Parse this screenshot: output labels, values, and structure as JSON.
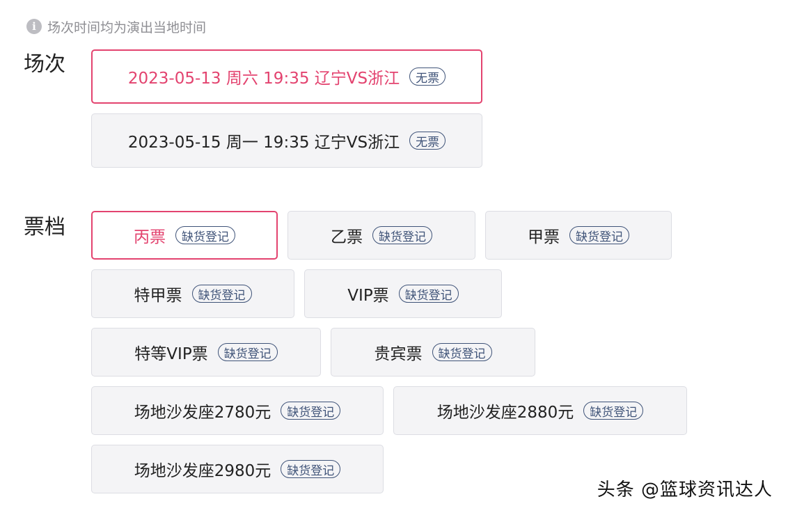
{
  "notice": {
    "icon": "info-icon",
    "text": "场次时间均为演出当地时间"
  },
  "sessions": {
    "label": "场次",
    "items": [
      {
        "text": "2023-05-13 周六 19:35 辽宁VS浙江",
        "tag": "无票",
        "selected": true
      },
      {
        "text": "2023-05-15 周一 19:35 辽宁VS浙江",
        "tag": "无票",
        "selected": false
      }
    ]
  },
  "tiers": {
    "label": "票档",
    "items": [
      {
        "name": "丙票",
        "tag": "缺货登记",
        "selected": true
      },
      {
        "name": "乙票",
        "tag": "缺货登记",
        "selected": false
      },
      {
        "name": "甲票",
        "tag": "缺货登记",
        "selected": false
      },
      {
        "name": "特甲票",
        "tag": "缺货登记",
        "selected": false
      },
      {
        "name": "VIP票",
        "tag": "缺货登记",
        "selected": false
      },
      {
        "name": "特等VIP票",
        "tag": "缺货登记",
        "selected": false
      },
      {
        "name": "贵宾票",
        "tag": "缺货登记",
        "selected": false
      },
      {
        "name": "场地沙发座2780元",
        "tag": "缺货登记",
        "selected": false
      },
      {
        "name": "场地沙发座2880元",
        "tag": "缺货登记",
        "selected": false
      },
      {
        "name": "场地沙发座2980元",
        "tag": "缺货登记",
        "selected": false
      }
    ]
  },
  "watermark": "头条 @篮球资讯达人",
  "colors": {
    "accent": "#e3436f",
    "tag": "#3f5378",
    "option_bg": "#f4f4f6",
    "border": "#dcdde3"
  }
}
